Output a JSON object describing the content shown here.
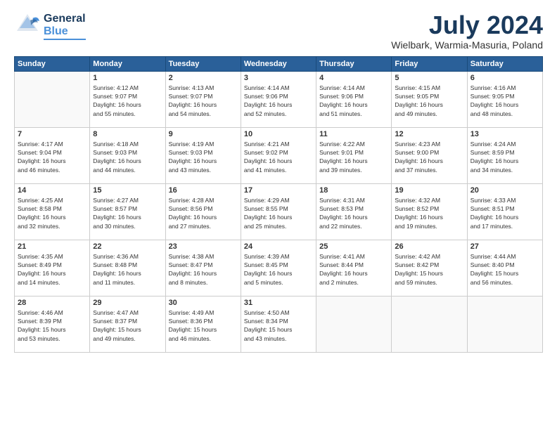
{
  "header": {
    "logo_general": "General",
    "logo_blue": "Blue",
    "month_title": "July 2024",
    "location": "Wielbark, Warmia-Masuria, Poland"
  },
  "days_of_week": [
    "Sunday",
    "Monday",
    "Tuesday",
    "Wednesday",
    "Thursday",
    "Friday",
    "Saturday"
  ],
  "weeks": [
    [
      {
        "day": "",
        "info": ""
      },
      {
        "day": "1",
        "info": "Sunrise: 4:12 AM\nSunset: 9:07 PM\nDaylight: 16 hours\nand 55 minutes."
      },
      {
        "day": "2",
        "info": "Sunrise: 4:13 AM\nSunset: 9:07 PM\nDaylight: 16 hours\nand 54 minutes."
      },
      {
        "day": "3",
        "info": "Sunrise: 4:14 AM\nSunset: 9:06 PM\nDaylight: 16 hours\nand 52 minutes."
      },
      {
        "day": "4",
        "info": "Sunrise: 4:14 AM\nSunset: 9:06 PM\nDaylight: 16 hours\nand 51 minutes."
      },
      {
        "day": "5",
        "info": "Sunrise: 4:15 AM\nSunset: 9:05 PM\nDaylight: 16 hours\nand 49 minutes."
      },
      {
        "day": "6",
        "info": "Sunrise: 4:16 AM\nSunset: 9:05 PM\nDaylight: 16 hours\nand 48 minutes."
      }
    ],
    [
      {
        "day": "7",
        "info": "Sunrise: 4:17 AM\nSunset: 9:04 PM\nDaylight: 16 hours\nand 46 minutes."
      },
      {
        "day": "8",
        "info": "Sunrise: 4:18 AM\nSunset: 9:03 PM\nDaylight: 16 hours\nand 44 minutes."
      },
      {
        "day": "9",
        "info": "Sunrise: 4:19 AM\nSunset: 9:03 PM\nDaylight: 16 hours\nand 43 minutes."
      },
      {
        "day": "10",
        "info": "Sunrise: 4:21 AM\nSunset: 9:02 PM\nDaylight: 16 hours\nand 41 minutes."
      },
      {
        "day": "11",
        "info": "Sunrise: 4:22 AM\nSunset: 9:01 PM\nDaylight: 16 hours\nand 39 minutes."
      },
      {
        "day": "12",
        "info": "Sunrise: 4:23 AM\nSunset: 9:00 PM\nDaylight: 16 hours\nand 37 minutes."
      },
      {
        "day": "13",
        "info": "Sunrise: 4:24 AM\nSunset: 8:59 PM\nDaylight: 16 hours\nand 34 minutes."
      }
    ],
    [
      {
        "day": "14",
        "info": "Sunrise: 4:25 AM\nSunset: 8:58 PM\nDaylight: 16 hours\nand 32 minutes."
      },
      {
        "day": "15",
        "info": "Sunrise: 4:27 AM\nSunset: 8:57 PM\nDaylight: 16 hours\nand 30 minutes."
      },
      {
        "day": "16",
        "info": "Sunrise: 4:28 AM\nSunset: 8:56 PM\nDaylight: 16 hours\nand 27 minutes."
      },
      {
        "day": "17",
        "info": "Sunrise: 4:29 AM\nSunset: 8:55 PM\nDaylight: 16 hours\nand 25 minutes."
      },
      {
        "day": "18",
        "info": "Sunrise: 4:31 AM\nSunset: 8:53 PM\nDaylight: 16 hours\nand 22 minutes."
      },
      {
        "day": "19",
        "info": "Sunrise: 4:32 AM\nSunset: 8:52 PM\nDaylight: 16 hours\nand 19 minutes."
      },
      {
        "day": "20",
        "info": "Sunrise: 4:33 AM\nSunset: 8:51 PM\nDaylight: 16 hours\nand 17 minutes."
      }
    ],
    [
      {
        "day": "21",
        "info": "Sunrise: 4:35 AM\nSunset: 8:49 PM\nDaylight: 16 hours\nand 14 minutes."
      },
      {
        "day": "22",
        "info": "Sunrise: 4:36 AM\nSunset: 8:48 PM\nDaylight: 16 hours\nand 11 minutes."
      },
      {
        "day": "23",
        "info": "Sunrise: 4:38 AM\nSunset: 8:47 PM\nDaylight: 16 hours\nand 8 minutes."
      },
      {
        "day": "24",
        "info": "Sunrise: 4:39 AM\nSunset: 8:45 PM\nDaylight: 16 hours\nand 5 minutes."
      },
      {
        "day": "25",
        "info": "Sunrise: 4:41 AM\nSunset: 8:44 PM\nDaylight: 16 hours\nand 2 minutes."
      },
      {
        "day": "26",
        "info": "Sunrise: 4:42 AM\nSunset: 8:42 PM\nDaylight: 15 hours\nand 59 minutes."
      },
      {
        "day": "27",
        "info": "Sunrise: 4:44 AM\nSunset: 8:40 PM\nDaylight: 15 hours\nand 56 minutes."
      }
    ],
    [
      {
        "day": "28",
        "info": "Sunrise: 4:46 AM\nSunset: 8:39 PM\nDaylight: 15 hours\nand 53 minutes."
      },
      {
        "day": "29",
        "info": "Sunrise: 4:47 AM\nSunset: 8:37 PM\nDaylight: 15 hours\nand 49 minutes."
      },
      {
        "day": "30",
        "info": "Sunrise: 4:49 AM\nSunset: 8:36 PM\nDaylight: 15 hours\nand 46 minutes."
      },
      {
        "day": "31",
        "info": "Sunrise: 4:50 AM\nSunset: 8:34 PM\nDaylight: 15 hours\nand 43 minutes."
      },
      {
        "day": "",
        "info": ""
      },
      {
        "day": "",
        "info": ""
      },
      {
        "day": "",
        "info": ""
      }
    ]
  ]
}
